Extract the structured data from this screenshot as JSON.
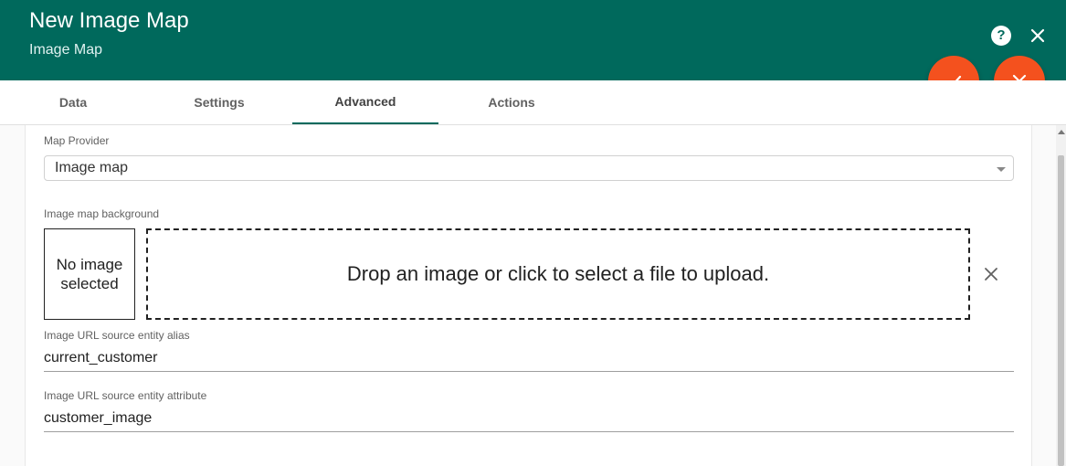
{
  "header": {
    "title": "New Image Map",
    "subtitle": "Image Map",
    "help_glyph": "?",
    "background_color": "#00695c"
  },
  "actions": {
    "fab_color": "#f4511e",
    "confirm_icon": "check-icon",
    "cancel_icon": "close-icon"
  },
  "tabs": [
    {
      "label": "Data",
      "active": false
    },
    {
      "label": "Settings",
      "active": false
    },
    {
      "label": "Advanced",
      "active": true
    },
    {
      "label": "Actions",
      "active": false
    }
  ],
  "form": {
    "map_provider": {
      "label": "Map Provider",
      "value": "Image map"
    },
    "background": {
      "label": "Image map background",
      "no_image_text": "No image selected",
      "dropzone_text": "Drop an image or click to select a file to upload."
    },
    "entity_alias": {
      "label": "Image URL source entity alias",
      "value": "current_customer"
    },
    "entity_attribute": {
      "label": "Image URL source entity attribute",
      "value": "customer_image"
    }
  }
}
